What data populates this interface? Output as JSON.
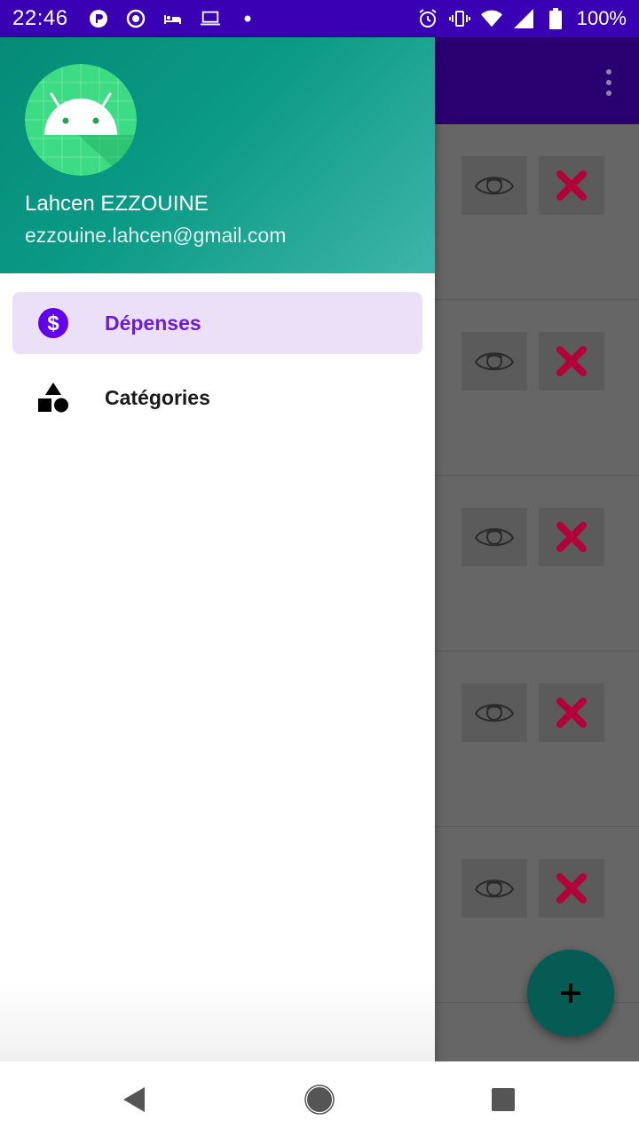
{
  "status_bar": {
    "time": "22:46",
    "battery": "100%"
  },
  "app": {
    "overflow_icon": "more-vert-icon",
    "row_count": 5,
    "view_icon": "eye-icon",
    "delete_icon": "close-icon",
    "fab_icon": "add-icon",
    "delete_color": "#b3003a"
  },
  "drawer": {
    "user_name": "Lahcen EZZOUINE",
    "user_email": "ezzouine.lahcen@gmail.com",
    "items": [
      {
        "label": "Dépenses",
        "icon": "dollar-icon",
        "active": true
      },
      {
        "label": "Catégories",
        "icon": "category-shapes-icon",
        "active": false
      }
    ],
    "accent_color": "#6200ee"
  },
  "nav_bar": {
    "back_icon": "back-triangle-icon",
    "home_icon": "home-circle-icon",
    "recents_icon": "recents-square-icon"
  }
}
